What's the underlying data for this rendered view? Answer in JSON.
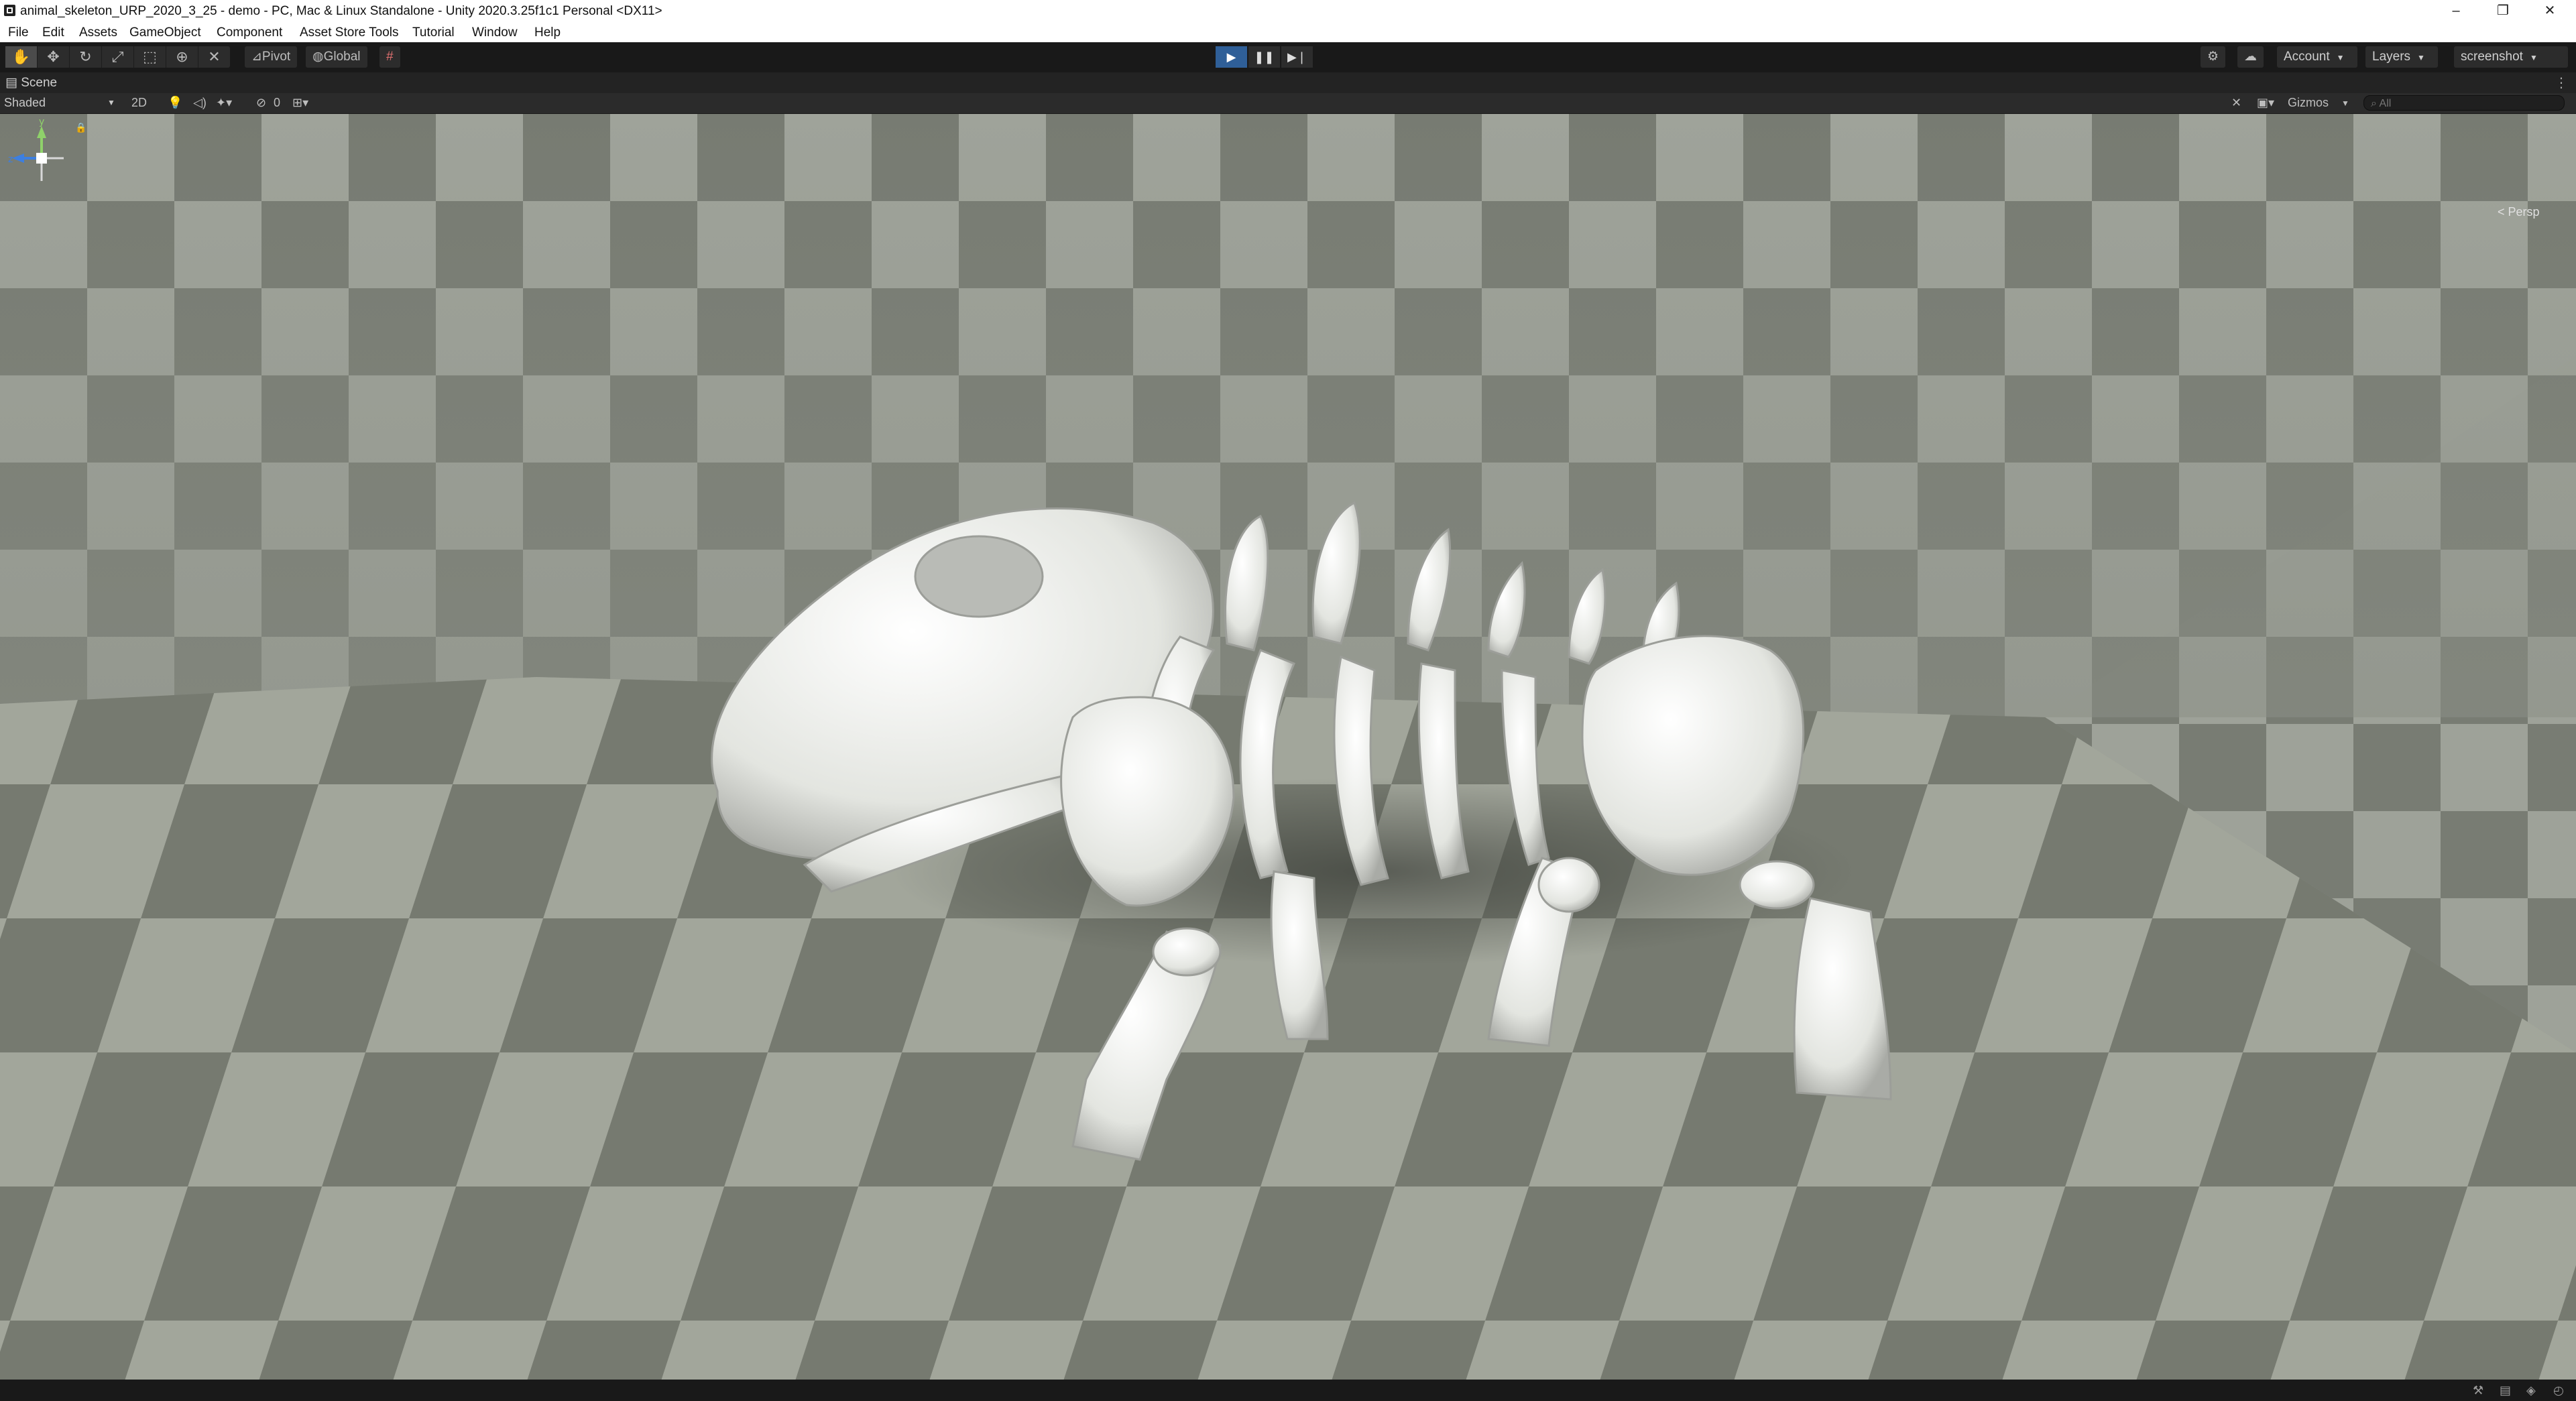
{
  "window": {
    "title": "animal_skeleton_URP_2020_3_25 - demo - PC, Mac & Linux Standalone - Unity 2020.3.25f1c1 Personal <DX11>",
    "controls": {
      "minimize": "–",
      "maximize": "❐",
      "close": "✕"
    }
  },
  "menu": [
    "File",
    "Edit",
    "Assets",
    "GameObject",
    "Component",
    "Asset Store Tools",
    "Tutorial",
    "Window",
    "Help"
  ],
  "toolbar": {
    "tools": [
      "hand-tool",
      "move-tool",
      "rotate-tool",
      "scale-tool",
      "rect-tool",
      "transform-tool",
      "custom-tool"
    ],
    "pivot_label": "Pivot",
    "global_label": "Global",
    "account_label": "Account",
    "layers_label": "Layers",
    "layout_label": "screenshot"
  },
  "scene": {
    "tab_label": "Scene",
    "shading_mode": "Shaded",
    "mode_2d_label": "2D",
    "hidden_count": "0",
    "gizmos_label": "Gizmos",
    "search_placeholder": "All",
    "projection_label": "< Persp"
  },
  "colors": {
    "accent_play": "#2f5f98",
    "floor_light": "#a3a79d",
    "floor_dark": "#6f736a",
    "bone": "#eceeea"
  }
}
